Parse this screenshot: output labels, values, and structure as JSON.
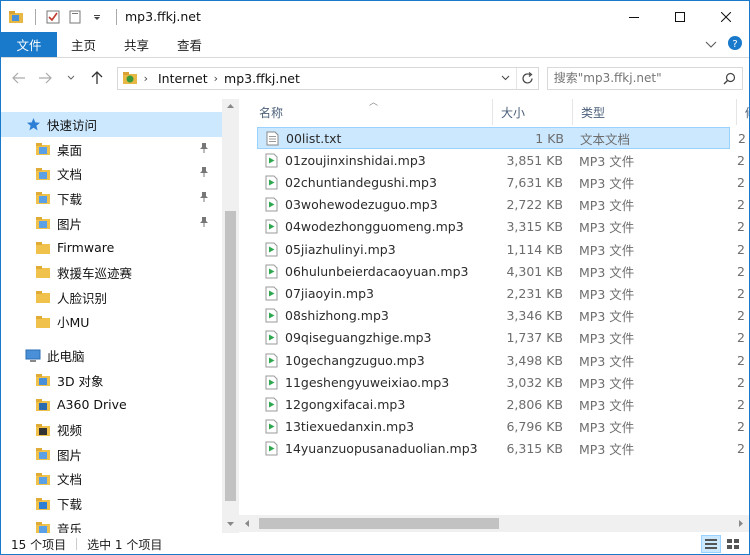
{
  "window": {
    "title": "mp3.ffkj.net"
  },
  "ribbon": {
    "tabs": [
      "文件",
      "主页",
      "共享",
      "查看"
    ]
  },
  "address": {
    "crumbs": [
      "Internet",
      "mp3.ffkj.net"
    ],
    "search_placeholder": "搜索\"mp3.ffkj.net\""
  },
  "sidebar": {
    "quick_access": "快速访问",
    "quick_items": [
      {
        "label": "桌面",
        "pinned": true
      },
      {
        "label": "文档",
        "pinned": true
      },
      {
        "label": "下载",
        "pinned": true
      },
      {
        "label": "图片",
        "pinned": true
      },
      {
        "label": "Firmware",
        "pinned": false
      },
      {
        "label": "救援车巡迹赛",
        "pinned": false
      },
      {
        "label": "人脸识别",
        "pinned": false
      },
      {
        "label": "小MU",
        "pinned": false
      }
    ],
    "this_pc": "此电脑",
    "pc_items": [
      "3D 对象",
      "A360 Drive",
      "视频",
      "图片",
      "文档",
      "下载",
      "音乐"
    ]
  },
  "list": {
    "headers": {
      "name": "名称",
      "size": "大小",
      "type": "类型",
      "extra": "修"
    },
    "rows": [
      {
        "name": "00list.txt",
        "size": "1 KB",
        "type": "文本文档",
        "extra": "2",
        "kind": "txt",
        "selected": true
      },
      {
        "name": "01zoujinxinshidai.mp3",
        "size": "3,851 KB",
        "type": "MP3 文件",
        "extra": "2",
        "kind": "mp3"
      },
      {
        "name": "02chuntiandegushi.mp3",
        "size": "7,631 KB",
        "type": "MP3 文件",
        "extra": "2",
        "kind": "mp3"
      },
      {
        "name": "03wohewodezuguo.mp3",
        "size": "2,722 KB",
        "type": "MP3 文件",
        "extra": "2",
        "kind": "mp3"
      },
      {
        "name": "04wodezhongguomeng.mp3",
        "size": "3,315 KB",
        "type": "MP3 文件",
        "extra": "2",
        "kind": "mp3"
      },
      {
        "name": "05jiazhulinyi.mp3",
        "size": "1,114 KB",
        "type": "MP3 文件",
        "extra": "2",
        "kind": "mp3"
      },
      {
        "name": "06hulunbeierdacaoyuan.mp3",
        "size": "4,301 KB",
        "type": "MP3 文件",
        "extra": "2",
        "kind": "mp3"
      },
      {
        "name": "07jiaoyin.mp3",
        "size": "2,231 KB",
        "type": "MP3 文件",
        "extra": "2",
        "kind": "mp3"
      },
      {
        "name": "08shizhong.mp3",
        "size": "3,346 KB",
        "type": "MP3 文件",
        "extra": "2",
        "kind": "mp3"
      },
      {
        "name": "09qiseguangzhige.mp3",
        "size": "1,737 KB",
        "type": "MP3 文件",
        "extra": "2",
        "kind": "mp3"
      },
      {
        "name": "10gechangzuguo.mp3",
        "size": "3,498 KB",
        "type": "MP3 文件",
        "extra": "2",
        "kind": "mp3"
      },
      {
        "name": "11geshengyuweixiao.mp3",
        "size": "3,032 KB",
        "type": "MP3 文件",
        "extra": "2",
        "kind": "mp3"
      },
      {
        "name": "12gongxifacai.mp3",
        "size": "2,806 KB",
        "type": "MP3 文件",
        "extra": "2",
        "kind": "mp3"
      },
      {
        "name": "13tiexuedanxin.mp3",
        "size": "6,796 KB",
        "type": "MP3 文件",
        "extra": "2",
        "kind": "mp3"
      },
      {
        "name": "14yuanzuopusanaduolian.mp3",
        "size": "6,315 KB",
        "type": "MP3 文件",
        "extra": "2",
        "kind": "mp3"
      }
    ]
  },
  "status": {
    "count": "15 个项目",
    "selected": "选中 1 个项目"
  },
  "colors": {
    "accent": "#1979ca",
    "selection": "#cce8ff",
    "selection_border": "#99d1ff"
  }
}
